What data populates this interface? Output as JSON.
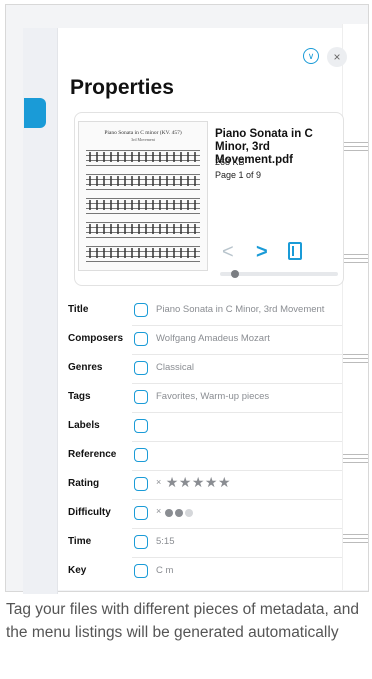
{
  "panel": {
    "title": "Properties",
    "header_icons": [
      "chevron-down-circle-icon",
      "close-icon"
    ],
    "close_glyph": "×",
    "chevron_glyph": "∨"
  },
  "file": {
    "name": "Piano Sonata in C Minor, 3rd Movement.pdf",
    "size": "268 KB",
    "page": "Page 1 of 9",
    "thumb_title": "Piano Sonata in C minor (KV. 457)",
    "thumb_subtitle": "3rd Movement",
    "nav": {
      "prev": "<",
      "next": ">"
    },
    "page_progress": 0.1111
  },
  "properties": [
    {
      "label": "Title",
      "value": "Piano Sonata in C Minor, 3rd Movement"
    },
    {
      "label": "Composers",
      "value": "Wolfgang Amadeus Mozart"
    },
    {
      "label": "Genres",
      "value": "Classical"
    },
    {
      "label": "Tags",
      "value": "Favorites, Warm-up pieces"
    },
    {
      "label": "Labels",
      "value": ""
    },
    {
      "label": "Reference",
      "value": ""
    },
    {
      "label": "Rating",
      "value": "",
      "clear": "×",
      "stars": "★★★★★",
      "rating": 0
    },
    {
      "label": "Difficulty",
      "value": "",
      "clear": "×",
      "difficulty": 2,
      "difficulty_max": 3
    },
    {
      "label": "Time",
      "value": "5:15"
    },
    {
      "label": "Key",
      "value": "C m"
    }
  ],
  "caption": "Tag your files with different pieces of metadata, and the menu listings will be generated automatically",
  "colors": {
    "accent": "#1a9bd7",
    "muted": "#8a8d92"
  }
}
